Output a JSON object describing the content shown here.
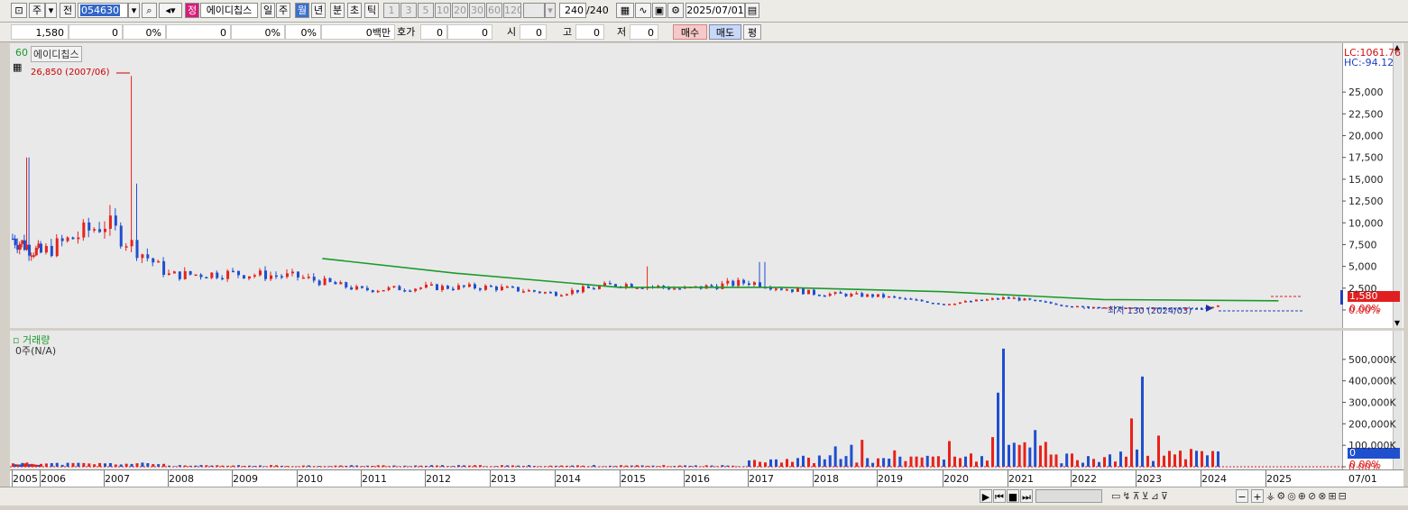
{
  "toolbar": {
    "market": "주",
    "mode": "전",
    "code": "054630",
    "badge": "정",
    "stock_name": "에이디칩스",
    "period_tabs": [
      "일",
      "주",
      "월",
      "년",
      "분",
      "초",
      "틱"
    ],
    "period_selected": "월",
    "interval_buttons": [
      "1",
      "3",
      "5",
      "10",
      "20",
      "30",
      "60",
      "120"
    ],
    "count": "240",
    "count_total": "/240",
    "date": "2025/07/01"
  },
  "info": {
    "price": "1,580",
    "change": "0",
    "change_pct": "0%",
    "volume": "0",
    "vol_pct": "0%",
    "turnover_pct": "0%",
    "amount": "0백만",
    "hoga_label": "호가",
    "hoga_ask": "0",
    "hoga_bid": "0",
    "open_label": "시",
    "open": "0",
    "high_label": "고",
    "high": "0",
    "low_label": "저",
    "low": "0",
    "buy_label": "매수",
    "sell_label": "매도",
    "avg_label": "평"
  },
  "price_panel": {
    "ma_label": "60",
    "stock_label": "에이디칩스",
    "high_marker": "26,850 (2007/06)",
    "low_marker": "최저 130 (2024/03)",
    "lc": "LC:1061.76",
    "hc": "HC:-94.12",
    "current_price_tag": "1,580",
    "current_pct_tag": "0.00%",
    "colors": {
      "up": "#e8221b",
      "down": "#1f4fcf",
      "ma": "#1a9a2a"
    }
  },
  "volume_panel": {
    "title": "거래량",
    "subtitle": "0주(N/A)",
    "current_tag": "0",
    "pct_tag": "0.00%"
  },
  "x_axis": {
    "labels": [
      "2005",
      "2006",
      "2007",
      "2008",
      "2009",
      "2010",
      "2011",
      "2012",
      "2013",
      "2014",
      "2015",
      "2016",
      "2017",
      "2018",
      "2019",
      "2020",
      "2021",
      "2022",
      "2023",
      "2024",
      "2025"
    ],
    "right_label": "07/01"
  },
  "chart_data": [
    {
      "type": "candlestick",
      "title": "에이디칩스",
      "yticks": [
        25000,
        22500,
        20000,
        17500,
        15000,
        12500,
        10000,
        7500,
        5000,
        2500,
        0
      ],
      "ylim": [
        0,
        27500
      ],
      "tick_labels": [
        "25,000",
        "22,500",
        "20,000",
        "17,500",
        "15,000",
        "12,500",
        "10,000",
        "7,500",
        "5,000",
        "2,500",
        "0.00%"
      ],
      "x_year_start": 2005,
      "closes_yearly_approx": {
        "2005": 8200,
        "2006": 6500,
        "2007": 10000,
        "2008": 4000,
        "2009": 4200,
        "2010": 3800,
        "2011": 2300,
        "2012": 2600,
        "2013": 2600,
        "2014": 1900,
        "2015": 3000,
        "2016": 2400,
        "2017": 3200,
        "2018": 1900,
        "2019": 1600,
        "2020": 700,
        "2021": 1400,
        "2022": 420,
        "2023": 220,
        "2024": 160,
        "2025": 1580
      },
      "series": [
        {
          "name": "60",
          "x": [
            2010.4,
            2012.5,
            2015.0,
            2017.5,
            2020.0,
            2022.5,
            2025.2
          ],
          "values": [
            5900,
            4200,
            2600,
            2600,
            2100,
            1200,
            1050
          ]
        }
      ]
    },
    {
      "type": "bar",
      "title": "거래량",
      "yticks": [
        500000,
        400000,
        300000,
        200000,
        100000,
        0
      ],
      "tick_labels": [
        "500,000K",
        "400,000K",
        "300,000K",
        "200,000K",
        "100,000K",
        "0.00%"
      ],
      "ylim": [
        0,
        600000
      ],
      "peaks": [
        {
          "x": 2020.85,
          "value": 345000
        },
        {
          "x": 2020.95,
          "value": 550000
        },
        {
          "x": 2022.9,
          "value": 225000
        },
        {
          "x": 2023.05,
          "value": 420000
        },
        {
          "x": 2023.3,
          "value": 145000
        }
      ]
    }
  ],
  "bottom_bar": {
    "zoom_minus": "−",
    "zoom_plus": "+"
  }
}
